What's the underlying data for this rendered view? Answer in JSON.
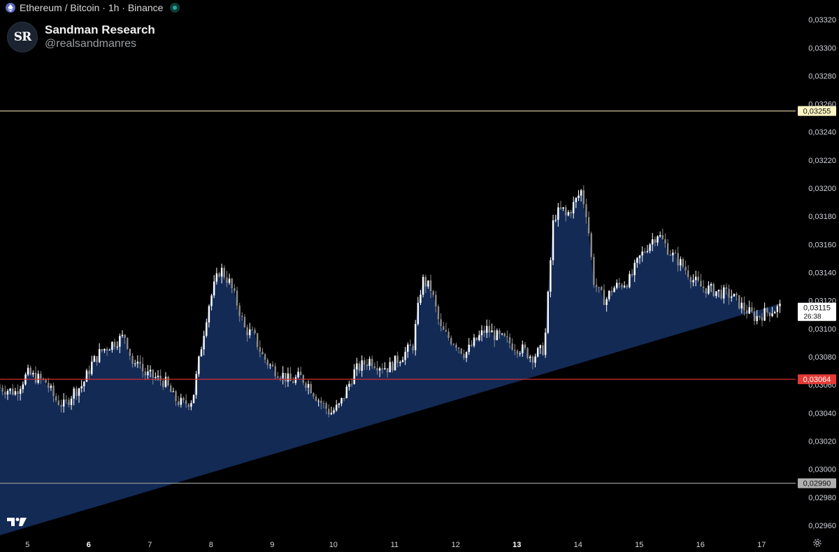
{
  "header": {
    "title": "Ethereum / Bitcoin · 1h · Binance",
    "pair_icon": "ethereum-icon",
    "status_icon": "market-open-dot-icon"
  },
  "brand": {
    "name": "Sandman Research",
    "handle": "@realsandmanres",
    "logo_text": "SR"
  },
  "footer": {
    "watermark_icon": "tradingview-logo-icon",
    "settings_icon": "gear-icon"
  },
  "colors": {
    "background": "#000000",
    "area_fill": "#132a55",
    "candle_up": "#ffffff",
    "candle_down": "#8c8c8c",
    "resistance_line": "#c9c097",
    "resistance_label_bg": "#fff6c4",
    "current_line": "#d32f2f",
    "current_label_bg": "#e53935",
    "support_line": "#8c8c8c",
    "support_label_bg": "#b0b0b0",
    "last_price_label_bg": "#ffffff"
  },
  "chart_data": {
    "type": "line",
    "chart_style": "candlestick with filled area",
    "title": "Ethereum / Bitcoin · 1h · Binance",
    "x_tick_labels": [
      "5",
      "6",
      "7",
      "8",
      "9",
      "10",
      "11",
      "12",
      "13",
      "14",
      "15",
      "16",
      "17"
    ],
    "x_tick_labels_bold": [
      "6",
      "13"
    ],
    "y_tick_labels": [
      "0,03320",
      "0,03300",
      "0,03280",
      "0,03260",
      "0,03240",
      "0,03220",
      "0,03200",
      "0,03180",
      "0,03160",
      "0,03140",
      "0,03120",
      "0,03100",
      "0,03080",
      "0,03060",
      "0,03040",
      "0,03020",
      "0,03000",
      "0,02980",
      "0,02960"
    ],
    "ylim": [
      0.02953,
      0.03334
    ],
    "xlim": [
      4.55,
      17.5
    ],
    "grid": false,
    "series": [
      {
        "x": [
          4.55,
          4.8,
          5.0,
          5.3,
          5.45,
          5.6,
          5.75,
          5.9,
          6.05,
          6.2,
          6.4,
          6.6,
          6.75,
          6.8,
          6.9,
          7.1,
          7.25,
          7.4,
          7.55,
          7.7,
          7.85,
          7.95,
          8.05,
          8.15,
          8.3,
          8.45,
          8.55,
          8.7,
          8.85,
          9.0,
          9.15,
          9.3,
          9.45,
          9.6,
          9.75,
          9.95,
          10.1,
          10.2,
          10.35,
          10.5,
          10.6,
          10.7,
          10.9,
          11.1,
          11.3,
          11.45,
          11.6,
          11.75,
          11.85,
          11.9,
          12.0,
          12.15,
          12.3,
          12.5,
          12.65,
          12.8,
          12.95,
          13.1,
          13.25,
          13.45,
          13.6,
          13.75,
          13.8,
          13.85,
          13.95,
          14.05,
          14.15,
          14.25,
          14.35,
          14.45,
          14.55,
          14.62,
          14.72,
          14.85,
          15.0,
          15.15,
          15.3,
          15.45,
          15.55,
          15.65,
          15.8,
          15.88,
          16.0,
          16.15,
          16.3,
          16.5,
          16.7,
          16.9,
          17.1,
          17.3,
          17.45
        ],
        "close": [
          0.03058,
          0.03055,
          0.03068,
          0.03062,
          0.0305,
          0.03045,
          0.03055,
          0.0306,
          0.03075,
          0.03084,
          0.0309,
          0.03095,
          0.0307,
          0.0308,
          0.03068,
          0.03065,
          0.03062,
          0.0305,
          0.03046,
          0.0305,
          0.0309,
          0.03115,
          0.0313,
          0.03143,
          0.03133,
          0.03115,
          0.031,
          0.03095,
          0.0308,
          0.03072,
          0.03068,
          0.03062,
          0.03066,
          0.0306,
          0.0305,
          0.0304,
          0.03045,
          0.03055,
          0.0307,
          0.03075,
          0.03078,
          0.03075,
          0.03072,
          0.0308,
          0.03088,
          0.03135,
          0.03128,
          0.031,
          0.03095,
          0.03093,
          0.0309,
          0.03082,
          0.0309,
          0.031,
          0.03095,
          0.03092,
          0.03088,
          0.03085,
          0.0308,
          0.03086,
          0.0318,
          0.03185,
          0.0318,
          0.03183,
          0.0319,
          0.03198,
          0.0318,
          0.03135,
          0.03125,
          0.0312,
          0.03128,
          0.0313,
          0.03132,
          0.03135,
          0.0315,
          0.0316,
          0.03168,
          0.03158,
          0.03152,
          0.03148,
          0.0314,
          0.03135,
          0.0313,
          0.03128,
          0.03126,
          0.03124,
          0.03115,
          0.03108,
          0.03112,
          0.03115
        ]
      }
    ],
    "horizontal_lines": [
      {
        "value": 0.03255,
        "label": "0,03255",
        "role": "resistance"
      },
      {
        "value": 0.03064,
        "label": "0,03064",
        "role": "current"
      },
      {
        "value": 0.0299,
        "label": "0,02990",
        "role": "support"
      }
    ],
    "last_price": {
      "value": 0.03115,
      "label": "0,03115",
      "countdown": "26:38"
    }
  }
}
